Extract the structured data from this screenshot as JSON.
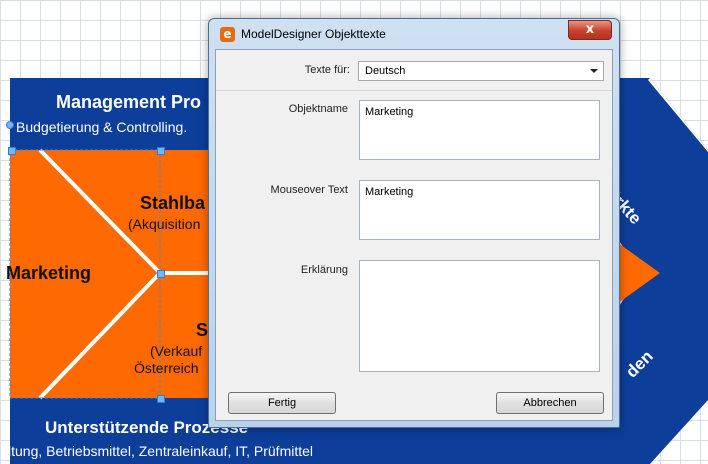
{
  "canvas": {
    "management_title": "Management Pro",
    "management_sub": "Budgetierung & Controlling.",
    "support_title": "Unterstützende Prozesse",
    "support_sub": "ltung, Betriebsmittel, Zentraleinkauf, IT, Prüfmittel",
    "marketing": "Marketing",
    "stahlbau": "Stahlba",
    "akquisition": "(Akquisition",
    "s_label": "S",
    "verkauf": "(Verkauf",
    "oesterreich": "Österreich",
    "right_top": "ärkte",
    "right_bottom": "den",
    "colors": {
      "blue": "#0d3e9a",
      "orange": "#ff6a00"
    }
  },
  "dialog": {
    "title": "ModelDesigner Objekttexte",
    "close_glyph": "x",
    "texte_fuer_label": "Texte für:",
    "language_value": "Deutsch",
    "objektname_label": "Objektname",
    "objektname_value": "Marketing",
    "mouseover_label": "Mouseover Text",
    "mouseover_value": "Marketing",
    "erklaerung_label": "Erklärung",
    "erklaerung_value": "",
    "fertig_button": "Fertig",
    "abbrechen_button": "Abbrechen"
  }
}
